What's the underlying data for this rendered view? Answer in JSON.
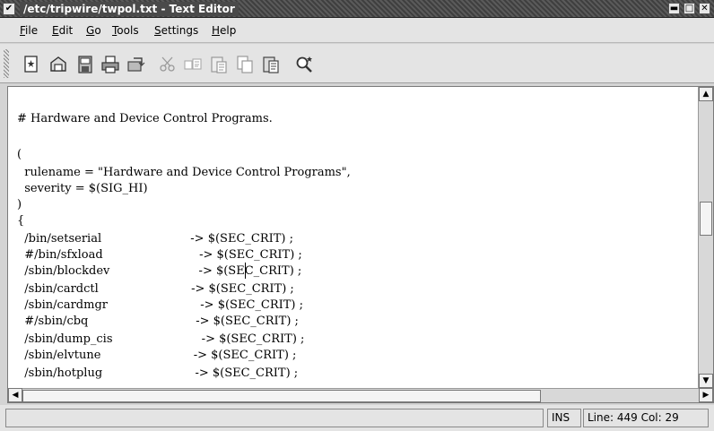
{
  "window": {
    "title": "/etc/tripwire/twpol.txt - Text Editor",
    "menu_glyph": "✔",
    "minimize_glyph": "▬",
    "maximize_glyph": "□",
    "close_glyph": "✕"
  },
  "menubar": {
    "items": [
      {
        "mnemonic": "F",
        "rest": "ile"
      },
      {
        "mnemonic": "E",
        "rest": "dit"
      },
      {
        "mnemonic": "G",
        "rest": "o"
      },
      {
        "mnemonic": "T",
        "rest": "ools"
      },
      {
        "mnemonic": "S",
        "rest": "ettings"
      },
      {
        "mnemonic": "H",
        "rest": "elp"
      }
    ]
  },
  "toolbar": {
    "icons": [
      "new-file-icon",
      "open-file-icon",
      "save-icon",
      "print-icon",
      "revert-icon",
      "cut-icon",
      "copy-icon",
      "paste-icon",
      "copy-document-icon",
      "paste-document-icon",
      "find-icon"
    ]
  },
  "editor": {
    "lines": [
      "",
      "# Hardware and Device Control Programs.",
      "",
      "(",
      "  rulename = \"Hardware and Device Control Programs\",",
      "  severity = $(SIG_HI)",
      ")",
      "{",
      "  /bin/setserial                        -> $(SEC_CRIT) ;",
      "  #/bin/sfxload                          -> $(SEC_CRIT) ;",
      "  /sbin/blockdev                        -> $(SEC_CRIT) ;",
      "  /sbin/cardctl                         -> $(SEC_CRIT) ;",
      "  /sbin/cardmgr                         -> $(SEC_CRIT) ;",
      "  #/sbin/cbq                             -> $(SEC_CRIT) ;",
      "  /sbin/dump_cis                        -> $(SEC_CRIT) ;",
      "  /sbin/elvtune                         -> $(SEC_CRIT) ;",
      "  /sbin/hotplug                         -> $(SEC_CRIT) ;"
    ]
  },
  "scroll": {
    "up_glyph": "▲",
    "down_glyph": "▼",
    "left_glyph": "◀",
    "right_glyph": "▶"
  },
  "statusbar": {
    "message": "",
    "mode": "INS",
    "position": "Line: 449 Col: 29"
  }
}
